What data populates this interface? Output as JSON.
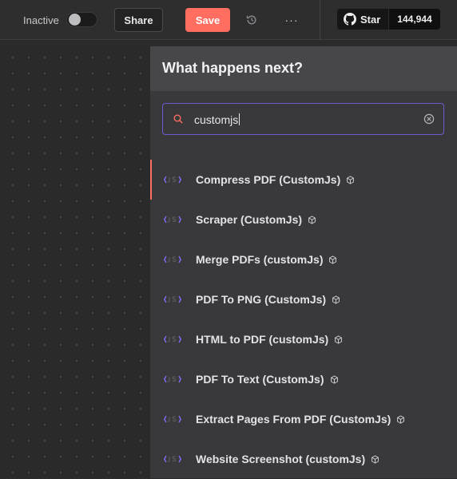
{
  "toolbar": {
    "inactive_label": "Inactive",
    "active": false,
    "share_label": "Share",
    "save_label": "Save",
    "more_label": "···",
    "github": {
      "star_label": "Star",
      "star_count": "144,944"
    }
  },
  "panel": {
    "title": "What happens next?",
    "search": {
      "value": "customjs"
    },
    "items": [
      {
        "label": "Compress PDF (CustomJs)",
        "icon": "customjs-logo-icon"
      },
      {
        "label": "Scraper (CustomJs)",
        "icon": "customjs-logo-icon"
      },
      {
        "label": "Merge PDFs (customJs)",
        "icon": "customjs-logo-icon"
      },
      {
        "label": "PDF To PNG (CustomJs)",
        "icon": "customjs-logo-icon"
      },
      {
        "label": "HTML to PDF (customJs)",
        "icon": "customjs-logo-icon"
      },
      {
        "label": "PDF To Text (CustomJs)",
        "icon": "customjs-logo-icon"
      },
      {
        "label": "Extract Pages From PDF (CustomJs)",
        "icon": "customjs-logo-icon"
      },
      {
        "label": "Website Screenshot (customJs)",
        "icon": "customjs-logo-icon"
      }
    ]
  },
  "colors": {
    "accent_save": "#ff6e61",
    "search_border": "#6e5bd0",
    "logo_purple": "#7b6cf0"
  }
}
